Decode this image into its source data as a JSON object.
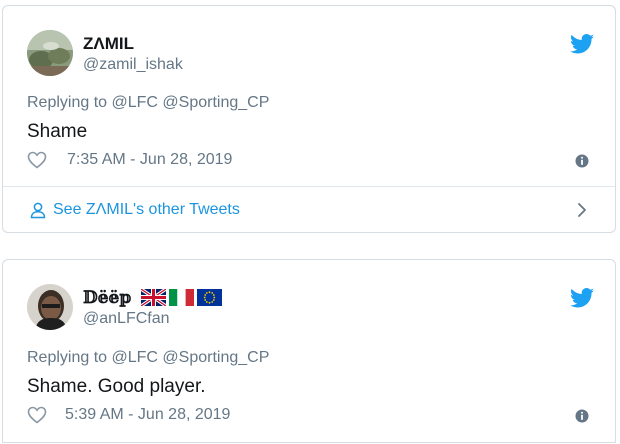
{
  "tweets": [
    {
      "display_name": "ZΛMIL",
      "handle": "@zamil_ishak",
      "reply_prefix": "Replying to",
      "reply_targets": "@LFC @Sporting_CP",
      "text": "Shame",
      "time": "7:35 AM - Jun 28, 2019",
      "see_more": "See ZΛMIL's other Tweets"
    },
    {
      "display_name": "𝔻𝕖̈𝕖̈𝕡",
      "handle": "@anLFCfan",
      "reply_prefix": "Replying to",
      "reply_targets": "@LFC @Sporting_CP",
      "text": "Shame. Good player.",
      "time": "5:39 AM - Jun 28, 2019",
      "flags": [
        "united-kingdom-flag",
        "italy-flag",
        "european-union-flag"
      ]
    }
  ],
  "colors": {
    "twitter_blue": "#1da1f2",
    "link_blue": "#1b95e0",
    "text_primary": "#14171a",
    "text_secondary": "#657786",
    "border": "#d6dde3"
  },
  "icons": {
    "brand": "twitter-bird-icon",
    "like": "heart-icon",
    "info": "info-icon",
    "user": "user-icon",
    "chevron": "chevron-right-icon"
  }
}
